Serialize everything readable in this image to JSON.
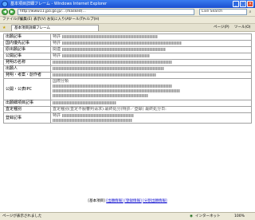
{
  "window": {
    "title": "基本項目詳細フレーム - Windows Internet Explorer",
    "min": "_",
    "max": "□",
    "close": "×"
  },
  "address": {
    "url": "http://www11.jpo.go.jp/…(masked)…",
    "search_placeholder": "Live Search"
  },
  "menu": [
    "ファイル(F)",
    "編集(E)",
    "表示(V)",
    "お気に入り(A)",
    "ツール(T)",
    "ヘルプ(H)"
  ],
  "tab": {
    "label": "基本項目詳細フレーム"
  },
  "commands": [
    "ページ(P)",
    "ツール(O)"
  ],
  "rows": [
    {
      "label": "出願記事",
      "value": "特許"
    },
    {
      "label": "国内優先記事",
      "value": "特許"
    },
    {
      "label": "原出願記事",
      "value": "関連"
    },
    {
      "label": "公開記事",
      "value": "特許"
    },
    {
      "label": "発明の名称",
      "value": ""
    },
    {
      "label": "出願人",
      "value": ""
    },
    {
      "label": "発明・考案・創作者",
      "value": ""
    },
    {
      "label": "公開・公表IPC",
      "value": "国際分類"
    },
    {
      "label": "出願細項目記事",
      "value": ""
    },
    {
      "label": "査定種別",
      "value": "査定種別(査定不服審判请求):最終処分(特許／登録) 最終処分日:"
    },
    {
      "label": "登録記事",
      "value": "特許"
    }
  ],
  "footer": {
    "prefix": "[基本項目]",
    "links": [
      "[出願情報]",
      "[登録情報]",
      "[分割出願情報]"
    ]
  },
  "status": {
    "left": "ページが表示されました",
    "zone": "インターネット",
    "zoom": "100%"
  }
}
